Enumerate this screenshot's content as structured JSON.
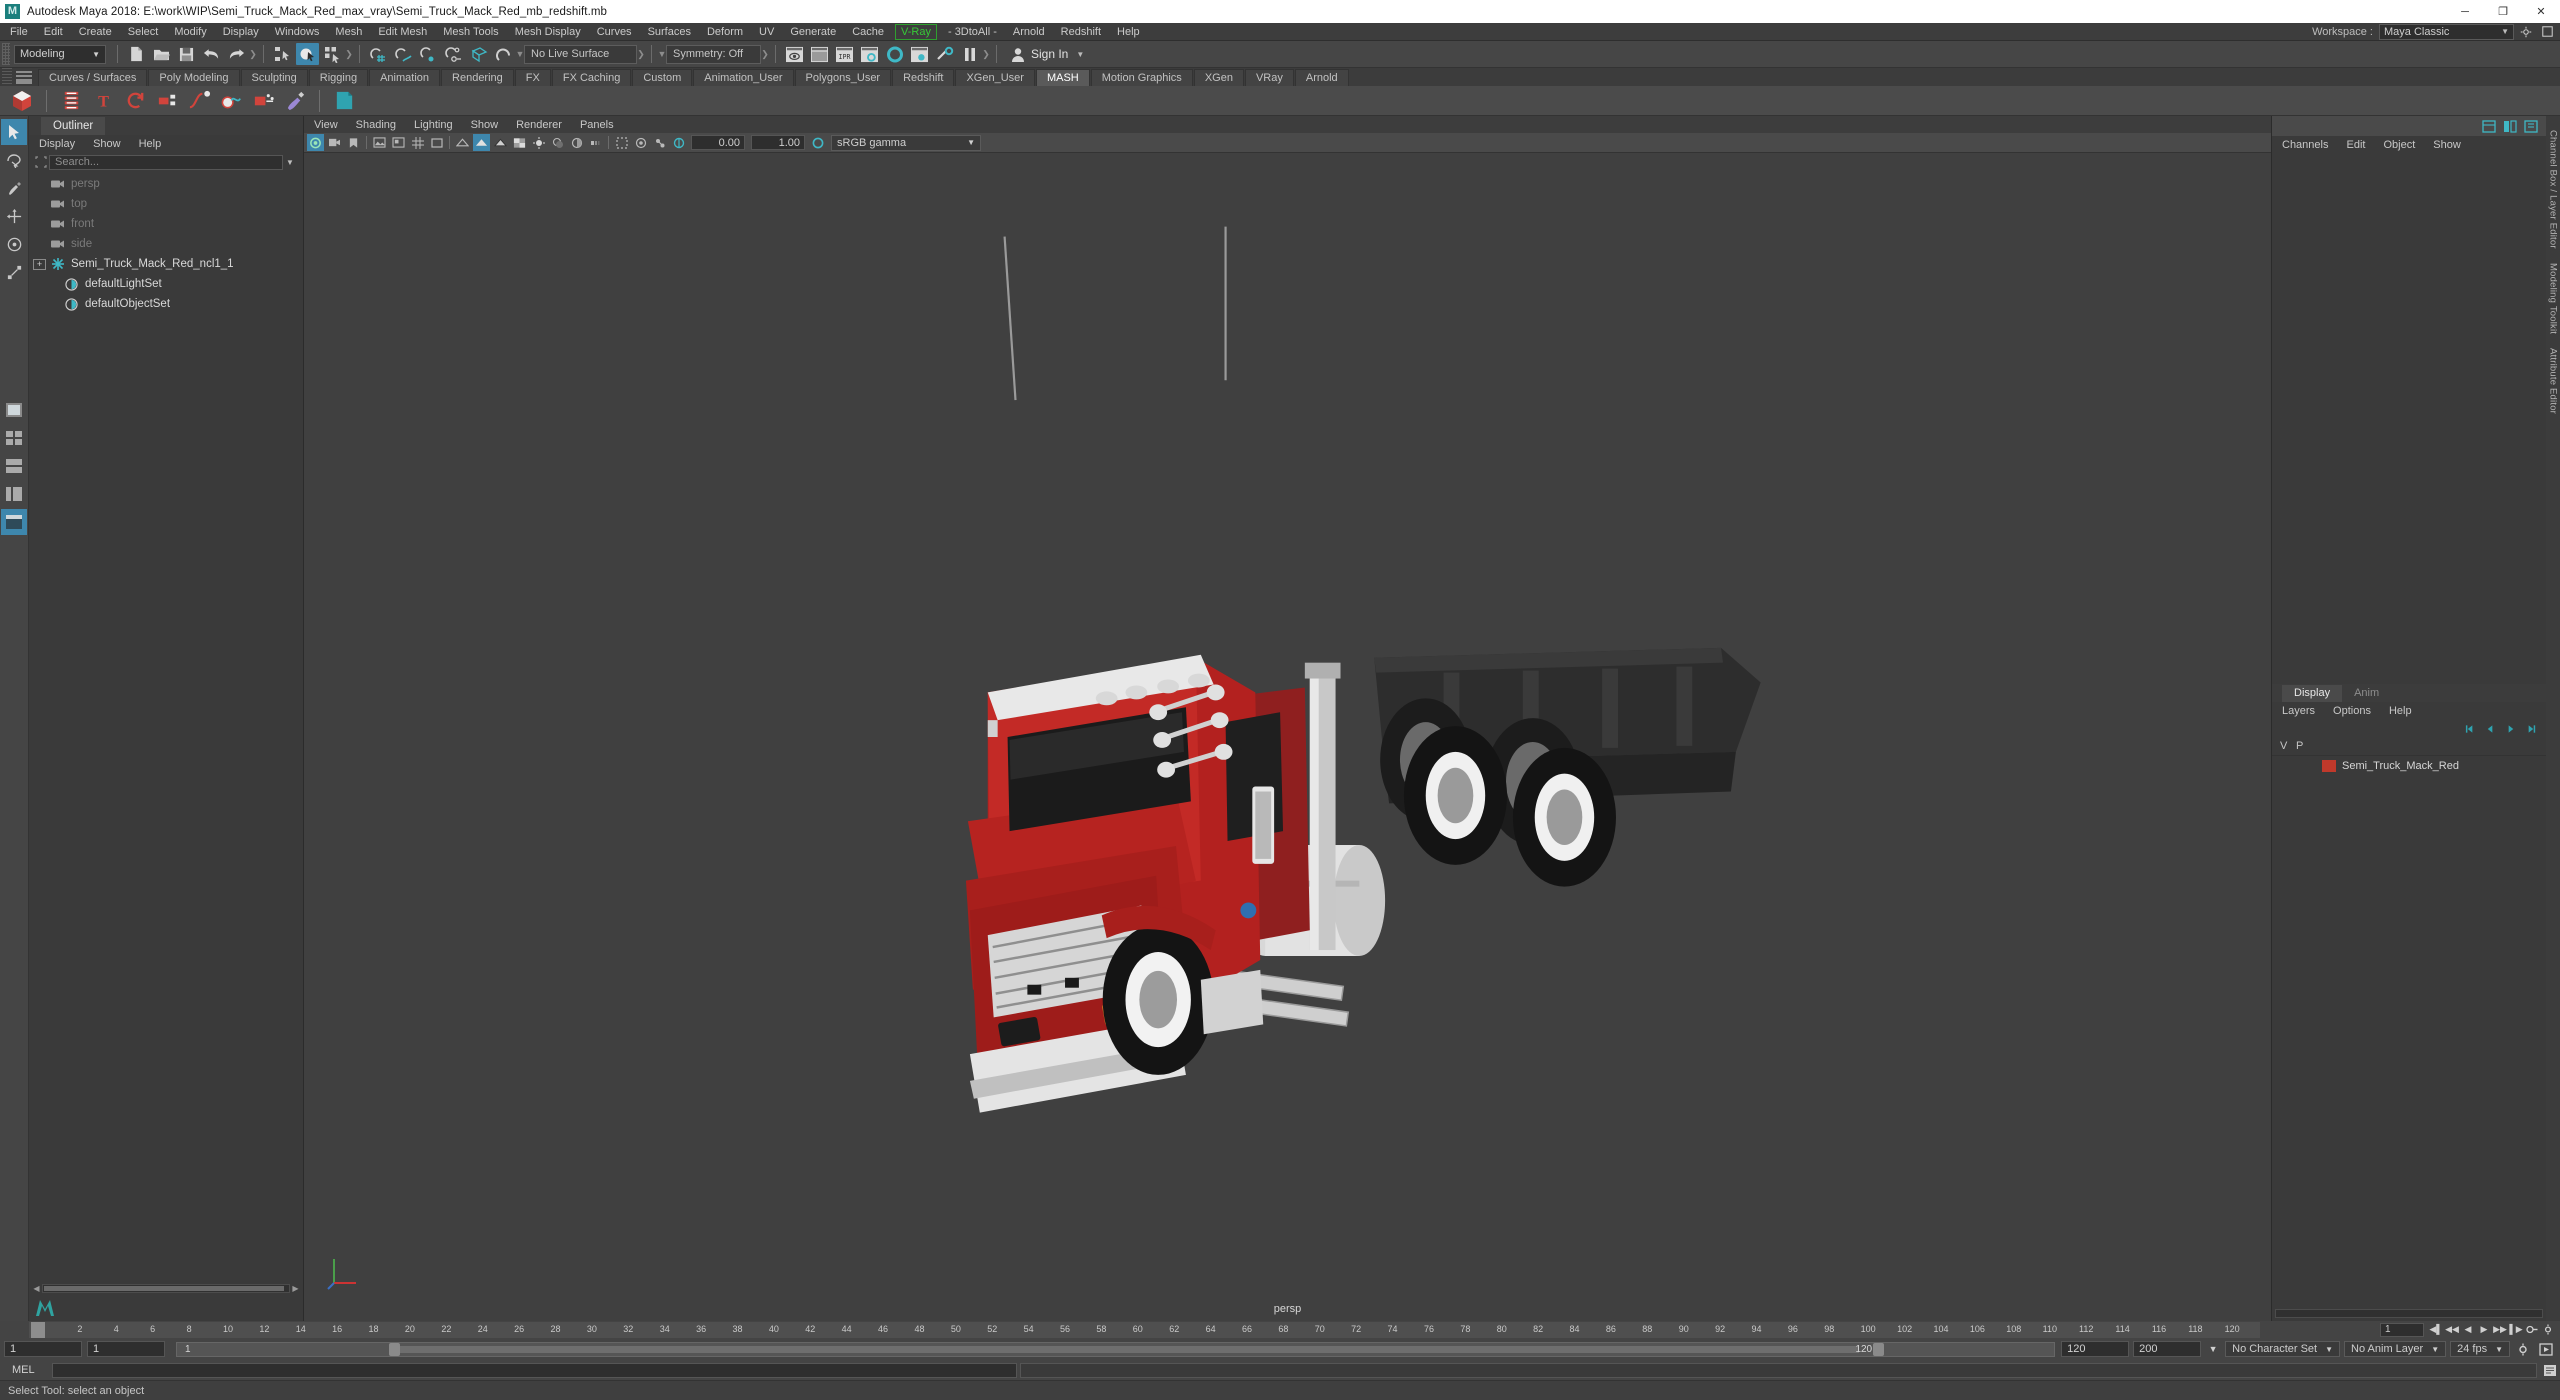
{
  "window": {
    "title": "Autodesk Maya 2018: E:\\work\\WIP\\Semi_Truck_Mack_Red_max_vray\\Semi_Truck_Mack_Red_mb_redshift.mb",
    "logo_text": "M",
    "minimize": "─",
    "maximize": "❐",
    "close": "✕"
  },
  "menubar": {
    "items": [
      "File",
      "Edit",
      "Create",
      "Select",
      "Modify",
      "Display",
      "Windows",
      "Mesh",
      "Edit Mesh",
      "Mesh Tools",
      "Mesh Display",
      "Curves",
      "Surfaces",
      "Deform",
      "UV",
      "Generate",
      "Cache"
    ],
    "vray": "V-Ray",
    "items_after": [
      "- 3DtoAll -",
      "Arnold",
      "Redshift",
      "Help"
    ],
    "workspace_label": "Workspace :",
    "workspace_value": "Maya Classic",
    "vray_color": "#37c837"
  },
  "statusline": {
    "mode": "Modeling",
    "live_surface": "No Live Surface",
    "symmetry": "Symmetry: Off",
    "signin": "Sign In"
  },
  "shelf": {
    "tabs": [
      "Curves / Surfaces",
      "Poly Modeling",
      "Sculpting",
      "Rigging",
      "Animation",
      "Rendering",
      "FX",
      "FX Caching",
      "Custom",
      "Animation_User",
      "Polygons_User",
      "Redshift",
      "XGen_User",
      "MASH",
      "Motion Graphics",
      "XGen",
      "VRay",
      "Arnold"
    ],
    "active_tab": "MASH"
  },
  "outliner": {
    "tab": "Outliner",
    "menus": [
      "Display",
      "Show",
      "Help"
    ],
    "search_placeholder": "Search...",
    "items": [
      {
        "label": "persp",
        "icon": "camera-icon",
        "dim": true,
        "expander": false
      },
      {
        "label": "top",
        "icon": "camera-icon",
        "dim": true,
        "expander": false
      },
      {
        "label": "front",
        "icon": "camera-icon",
        "dim": true,
        "expander": false
      },
      {
        "label": "side",
        "icon": "camera-icon",
        "dim": true,
        "expander": false
      },
      {
        "label": "Semi_Truck_Mack_Red_ncl1_1",
        "icon": "transform-icon",
        "dim": false,
        "expander": true
      },
      {
        "label": "defaultLightSet",
        "icon": "set-icon",
        "dim": false,
        "expander": false
      },
      {
        "label": "defaultObjectSet",
        "icon": "set-icon",
        "dim": false,
        "expander": false
      }
    ]
  },
  "viewport": {
    "menus": [
      "View",
      "Shading",
      "Lighting",
      "Show",
      "Renderer",
      "Panels"
    ],
    "exposure": "0.00",
    "gamma_value": "1.00",
    "color_space": "sRGB gamma",
    "camera_label": "persp",
    "background": "#404040"
  },
  "right_panel": {
    "menus": [
      "Channels",
      "Edit",
      "Object",
      "Show"
    ],
    "vtabs": [
      "Channel Box / Layer Editor",
      "Modeling Toolkit",
      "Attribute Editor"
    ],
    "layers": {
      "tabs": [
        {
          "label": "Display",
          "active": true
        },
        {
          "label": "Anim",
          "active": false
        }
      ],
      "menus": [
        "Layers",
        "Options",
        "Help"
      ],
      "headers": [
        "V",
        "P",
        ""
      ],
      "rows": [
        {
          "v": "",
          "p": "",
          "color": "#c0392b",
          "name": "Semi_Truck_Mack_Red"
        }
      ]
    }
  },
  "timeline": {
    "ticks": [
      "2",
      "4",
      "6",
      "8",
      "10",
      "12",
      "14",
      "16",
      "18",
      "20",
      "22",
      "24",
      "26",
      "28",
      "30",
      "32",
      "34",
      "36",
      "38",
      "40",
      "42",
      "44",
      "46",
      "48",
      "50",
      "52",
      "54",
      "56",
      "58",
      "60",
      "62",
      "64",
      "66",
      "68",
      "70",
      "72",
      "74",
      "76",
      "78",
      "80",
      "82",
      "84",
      "86",
      "88",
      "90",
      "92",
      "94",
      "96",
      "98",
      "100",
      "102",
      "104",
      "106",
      "108",
      "110",
      "112",
      "114",
      "116",
      "118",
      "120"
    ],
    "current_frame": "1",
    "range_start": "1",
    "range_field2": "1",
    "range_field3": "1",
    "range_end_label": "120",
    "playback_start": "120",
    "playback_end": "200",
    "character_set": "No Character Set",
    "anim_layer": "No Anim Layer",
    "fps": "24 fps"
  },
  "command_line": {
    "language": "MEL",
    "input_value": "",
    "output_value": ""
  },
  "help_line": {
    "text": "Select Tool: select an object"
  }
}
